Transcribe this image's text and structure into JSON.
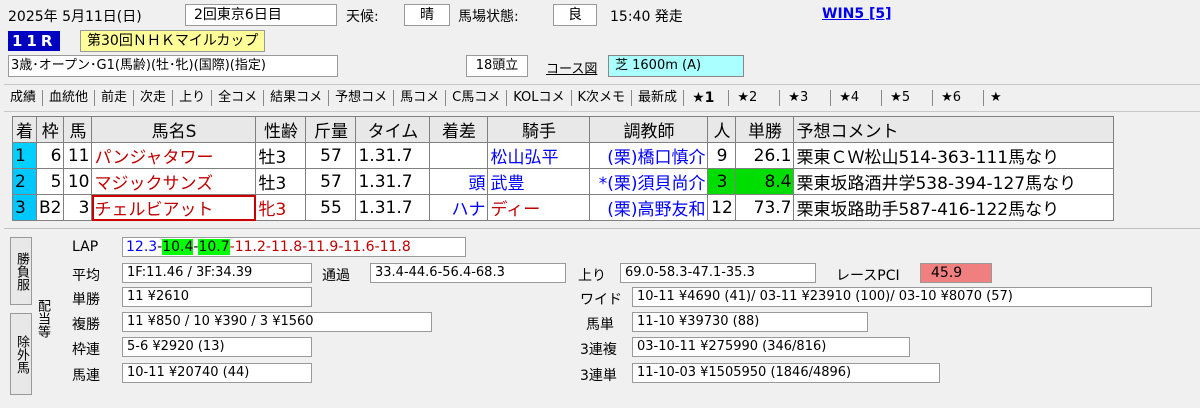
{
  "header": {
    "date": "2025年  5月11日(日)",
    "meeting": "2回東京6日目",
    "weather_label": "天候:",
    "weather": "晴",
    "track_label": "馬場状態:",
    "track": "良",
    "start_time": "15:40 発走",
    "win5": "WIN5 [5]",
    "race_number": "11R",
    "race_name": "第30回ＮＨＫマイルカップ",
    "race_conditions": "3歳･オープン･G1(馬齢)(牡･牝)(国際)(指定)",
    "runners": "18頭立",
    "course_link": "コース図",
    "course": "芝  1600m (A)"
  },
  "tabs": [
    "成績",
    "血統他",
    "前走",
    "次走",
    "上り",
    "全コメ",
    "結果コメ",
    "予想コメ",
    "馬コメ",
    "C馬コメ",
    "KOLコメ",
    "K次メモ",
    "最新成",
    "★1",
    "★2",
    "★3",
    "★4",
    "★5",
    "★6",
    "★"
  ],
  "table": {
    "headers": [
      "着",
      "枠",
      "馬",
      "馬名S",
      "性齢",
      "斤量",
      "タイム",
      "着差",
      "騎手",
      "調教師",
      "人",
      "単勝",
      "予想コメント"
    ],
    "rows": [
      {
        "rank": "1",
        "waku": "6",
        "uma": "11",
        "name": "パンジャタワー",
        "sex": "牡3",
        "weight": "57",
        "time": "1.31.7",
        "margin": "",
        "jockey": "松山弘平",
        "trainer": "(栗)橋口慎介",
        "pop": "9",
        "odds": "26.1",
        "comment": "栗東ＣＷ松山514-363-111馬なり"
      },
      {
        "rank": "2",
        "waku": "5",
        "uma": "10",
        "name": "マジックサンズ",
        "sex": "牡3",
        "weight": "57",
        "time": "1.31.7",
        "margin": "頭",
        "jockey": "武豊",
        "trainer": "*(栗)須貝尚介",
        "pop": "3",
        "odds": "8.4",
        "comment": "栗東坂路酒井学538-394-127馬なり"
      },
      {
        "rank": "3",
        "waku": "B2",
        "uma": "3",
        "name": "チェルビアット",
        "sex": "牝3",
        "weight": "55",
        "time": "1.31.7",
        "margin": "ハナ",
        "jockey": "ディー",
        "trainer": "(栗)高野友和",
        "pop": "12",
        "odds": "73.7",
        "comment": "栗東坂路助手587-416-122馬なり"
      }
    ]
  },
  "panel": {
    "vtab_result": "勝負服",
    "vtab_payout": "配当等",
    "vtab_excluded": "除外馬",
    "lap_label": "LAP",
    "lap": [
      "12.3",
      "10.4",
      "10.7",
      "11.2",
      "11.8",
      "11.9",
      "11.6",
      "11.8"
    ],
    "avg_label": "平均",
    "avg": "1F:11.46 / 3F:34.39",
    "pass_label": "通過",
    "pass": "33.4-44.6-56.4-68.3",
    "agari_label": "上り",
    "agari": "69.0-58.3-47.1-35.3",
    "pci_label": "レースPCI",
    "pci": "45.9",
    "tansho_label": "単勝",
    "tansho": "11 ¥2610",
    "wide_label": "ワイド",
    "wide": "10-11 ¥4690 (41)/ 03-11 ¥23910 (100)/ 03-10 ¥8070 (57)",
    "fukusho_label": "複勝",
    "fukusho": "11 ¥850 / 10 ¥390 / 3 ¥1560",
    "umatan_label": "馬単",
    "umatan": "11-10 ¥39730 (88)",
    "wakuren_label": "枠連",
    "wakuren": "5-6 ¥2920 (13)",
    "sanfuku_label": "3連複",
    "sanfuku": "03-10-11 ¥275990 (346/816)",
    "umaren_label": "馬連",
    "umaren": "10-11 ¥20740 (44)",
    "santan_label": "3連単",
    "santan": "11-10-03 ¥1505950 (1846/4896)"
  },
  "colors": {
    "rank_cell": "#00ccff",
    "fav_green": "#00dd00",
    "pci_bg": "#f08080",
    "race_name_bg": "#ffff99",
    "course_bg": "#aaffff"
  }
}
